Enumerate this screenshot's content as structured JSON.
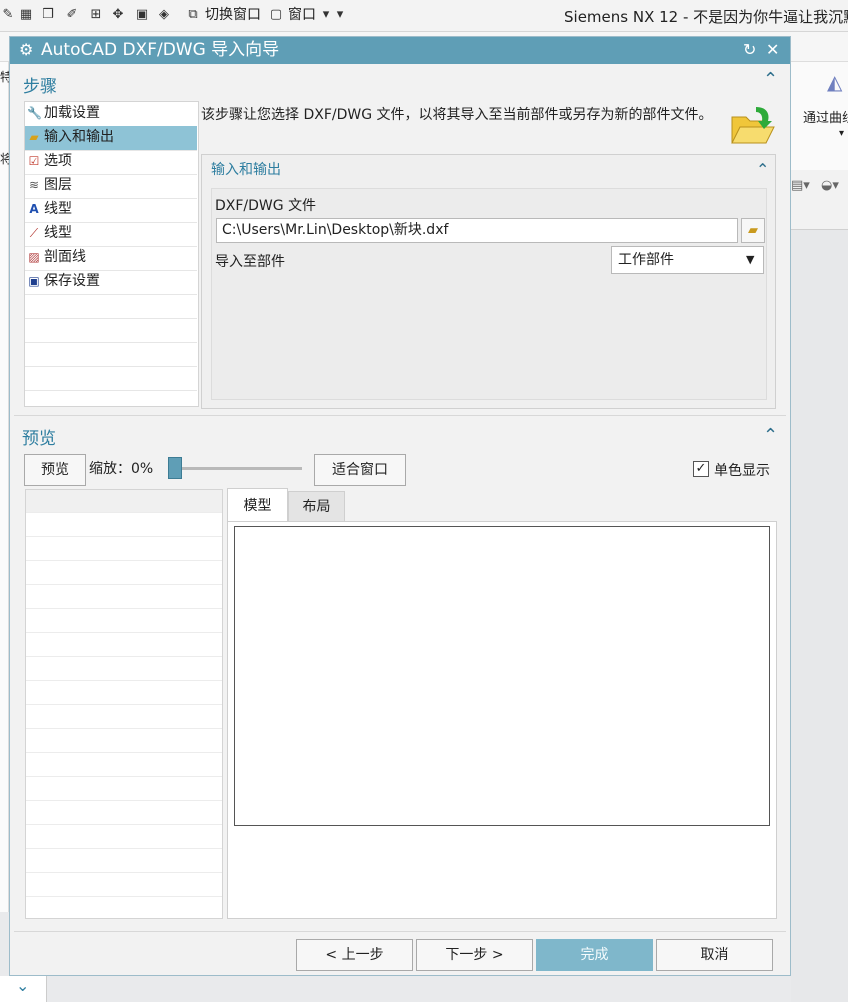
{
  "topbar": {
    "switch_window": "切换窗口",
    "window_menu": "窗口",
    "window_title": "Siemens NX 12 - 不是因为你牛逼让我沉默",
    "icons": [
      "edit-icon",
      "layout-icon",
      "cube-icon",
      "brush-icon",
      "grid-icon",
      "move-icon",
      "settings-icon",
      "paint-icon",
      "switch-window-icon",
      "window-icon",
      "dropdown-icon"
    ]
  },
  "background": {
    "right_label": "通过曲线",
    "left_frag1": "特",
    "left_frag2": "将"
  },
  "dialog": {
    "title": "AutoCAD DXF/DWG 导入向导",
    "accent": "#5f9eb6",
    "steps": {
      "heading": "步骤",
      "items": [
        {
          "label": "加载设置",
          "icon": "wrench-icon"
        },
        {
          "label": "输入和输出",
          "icon": "folder-icon"
        },
        {
          "label": "选项",
          "icon": "checklist-icon"
        },
        {
          "label": "图层",
          "icon": "layers-icon"
        },
        {
          "label": "线型",
          "icon": "font-icon"
        },
        {
          "label": "线型",
          "icon": "line-icon"
        },
        {
          "label": "剖面线",
          "icon": "hatch-icon"
        },
        {
          "label": "保存设置",
          "icon": "save-icon"
        }
      ],
      "selected_index": 1,
      "description": "该步骤让您选择 DXF/DWG 文件，以将其导入至当前部件或另存为新的部件文件。"
    },
    "io": {
      "heading": "输入和输出",
      "file_label": "DXF/DWG 文件",
      "file_value": "C:\\Users\\Mr.Lin\\Desktop\\新块.dxf",
      "import_to_label": "导入至部件",
      "import_to_value": "工作部件"
    },
    "preview": {
      "heading": "预览",
      "preview_button": "预览",
      "zoom_label": "缩放：0%",
      "zoom_value": 0,
      "fit_button": "适合窗口",
      "mono_label": "单色显示",
      "mono_checked": true,
      "tabs": [
        "模型",
        "布局"
      ],
      "active_tab": 0
    },
    "footer": {
      "prev": "< 上一步",
      "next": "下一步 >",
      "finish": "完成",
      "cancel": "取消"
    }
  }
}
